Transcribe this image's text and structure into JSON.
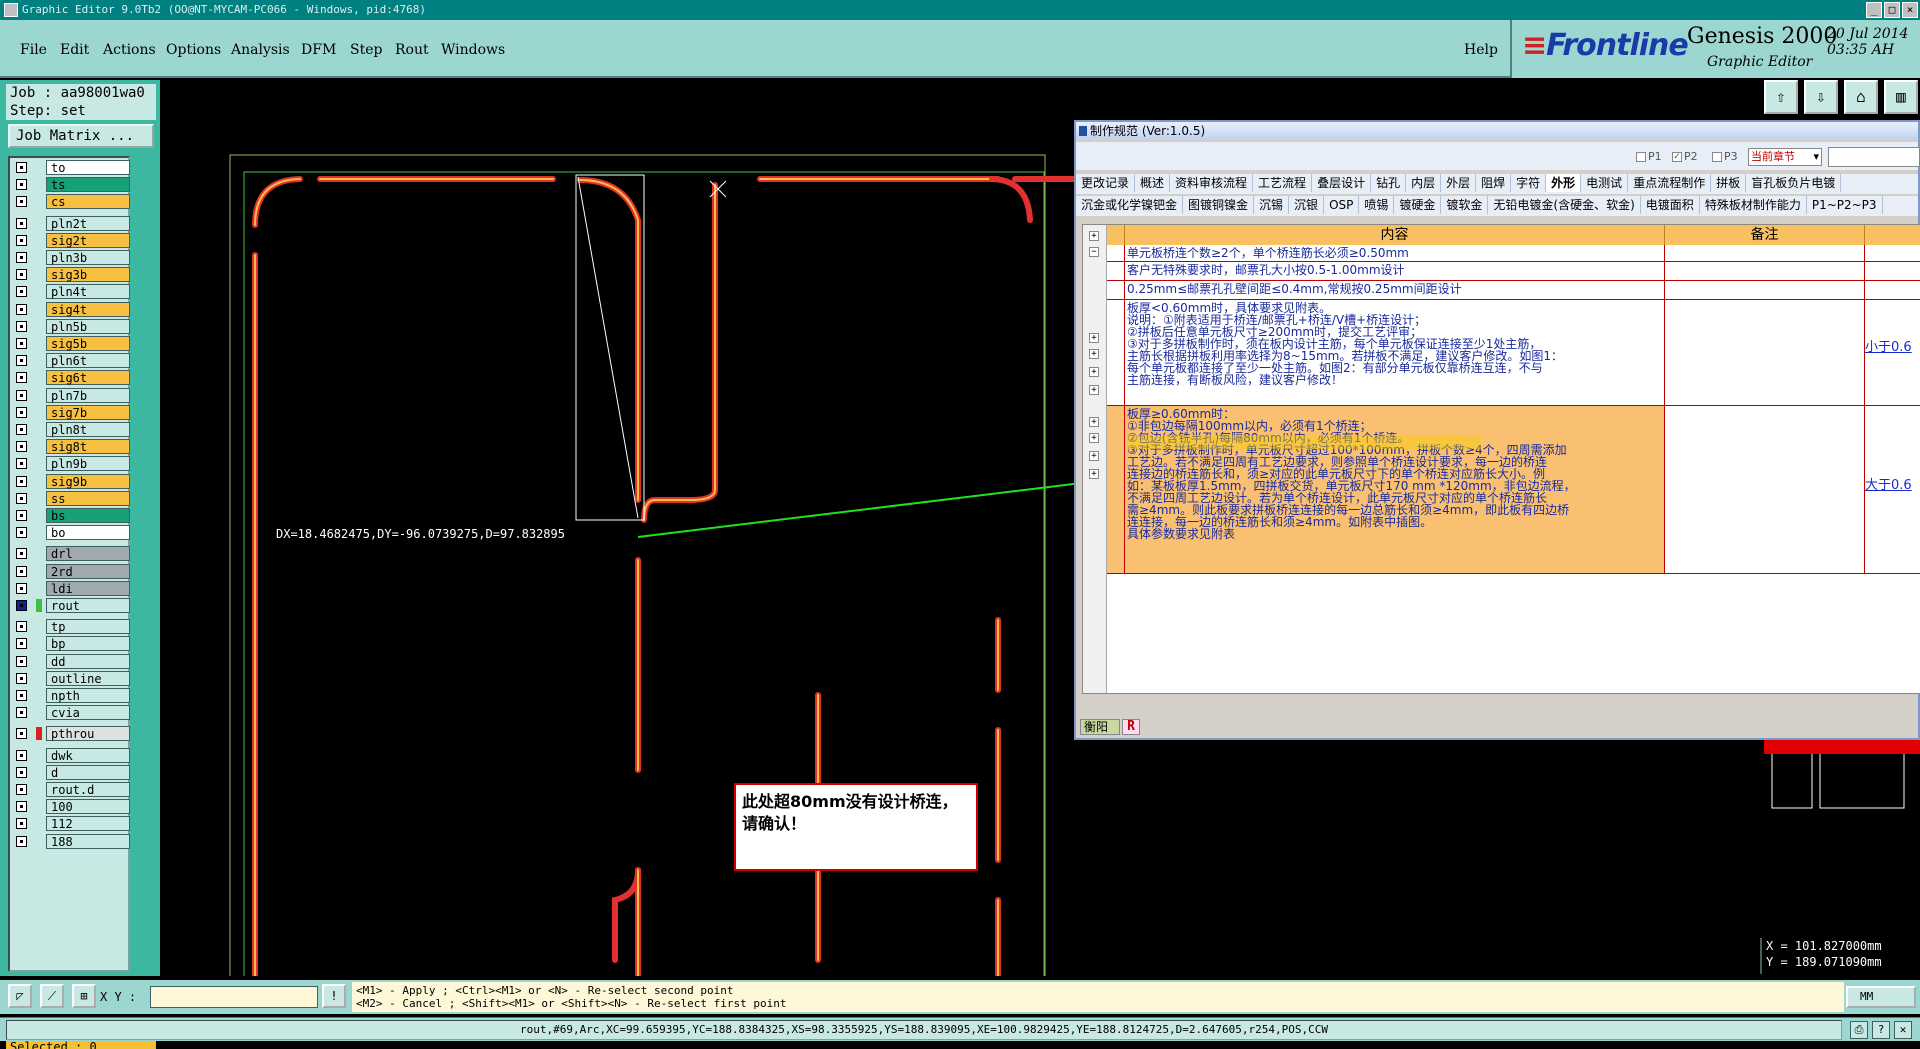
{
  "window": {
    "title": "Graphic Editor 9.0Tb2 (OO@NT-MYCAM-PC066 - Windows, pid:4768)",
    "controls": [
      "_",
      "□",
      "×"
    ]
  },
  "menu": {
    "items": [
      "File",
      "Edit",
      "Actions",
      "Options",
      "Analysis",
      "DFM",
      "Step",
      "Rout",
      "Windows"
    ],
    "help": "Help"
  },
  "brand": {
    "logo": "Frontline",
    "product": "Genesis 2000",
    "subtitle": "Graphic Editor",
    "date": "20 Jul 2014",
    "time": "03:35 AH"
  },
  "job": {
    "job_line": "Job : aa98001wa0",
    "step_line": "Step: set",
    "matrix_button": "Job Matrix ..."
  },
  "layers": [
    {
      "name": "to",
      "color": "#ffffff",
      "bg": "#ffffff"
    },
    {
      "name": "ts",
      "color": "#18a078",
      "bg": "#18a078"
    },
    {
      "name": "cs",
      "color": "#f8c040",
      "bg": "#f8c040"
    },
    {
      "name": "pln2t",
      "color": "#c8e8e4",
      "bg": "#c8e8e4"
    },
    {
      "name": "sig2t",
      "color": "#f8c040",
      "bg": "#f8c040"
    },
    {
      "name": "pln3b",
      "color": "#c8e8e4",
      "bg": "#c8e8e4"
    },
    {
      "name": "sig3b",
      "color": "#f8c040",
      "bg": "#f8c040"
    },
    {
      "name": "pln4t",
      "color": "#c8e8e4",
      "bg": "#c8e8e4"
    },
    {
      "name": "sig4t",
      "color": "#f8c040",
      "bg": "#f8c040"
    },
    {
      "name": "pln5b",
      "color": "#c8e8e4",
      "bg": "#c8e8e4"
    },
    {
      "name": "sig5b",
      "color": "#f8c040",
      "bg": "#f8c040"
    },
    {
      "name": "pln6t",
      "color": "#c8e8e4",
      "bg": "#c8e8e4"
    },
    {
      "name": "sig6t",
      "color": "#f8c040",
      "bg": "#f8c040"
    },
    {
      "name": "pln7b",
      "color": "#c8e8e4",
      "bg": "#c8e8e4"
    },
    {
      "name": "sig7b",
      "color": "#f8c040",
      "bg": "#f8c040"
    },
    {
      "name": "pln8t",
      "color": "#c8e8e4",
      "bg": "#c8e8e4"
    },
    {
      "name": "sig8t",
      "color": "#f8c040",
      "bg": "#f8c040"
    },
    {
      "name": "pln9b",
      "color": "#c8e8e4",
      "bg": "#c8e8e4"
    },
    {
      "name": "sig9b",
      "color": "#f8c040",
      "bg": "#f8c040"
    },
    {
      "name": "ss",
      "color": "#f8c040",
      "bg": "#f8c040"
    },
    {
      "name": "bs",
      "color": "#18a078",
      "bg": "#18a078"
    },
    {
      "name": "bo",
      "color": "#ffffff",
      "bg": "#ffffff"
    },
    {
      "name": "drl",
      "color": "#a0a8b0",
      "bg": "#a0a8b0"
    },
    {
      "name": "2rd",
      "color": "#a0a8b0",
      "bg": "#a0a8b0"
    },
    {
      "name": "ldi",
      "color": "#a0a8b0",
      "bg": "#a0a8b0"
    },
    {
      "name": "rout",
      "color": "#40c040",
      "bg": "#c8e8e4",
      "active": true
    },
    {
      "name": "tp",
      "color": "#c8e8e4",
      "bg": "#c8e8e4"
    },
    {
      "name": "bp",
      "color": "#c8e8e4",
      "bg": "#c8e8e4"
    },
    {
      "name": "dd",
      "color": "#c8e8e4",
      "bg": "#c8e8e4"
    },
    {
      "name": "outline",
      "color": "#c8e8e4",
      "bg": "#c8e8e4"
    },
    {
      "name": "npth",
      "color": "#c8e8e4",
      "bg": "#c8e8e4"
    },
    {
      "name": "cvia",
      "color": "#c8e8e4",
      "bg": "#c8e8e4"
    },
    {
      "name": "pthrou",
      "color": "#e02020",
      "bg": "#e0e0e0"
    },
    {
      "name": "dwk",
      "color": "#c8e8e4",
      "bg": "#c8e8e4"
    },
    {
      "name": "d",
      "color": "#c8e8e4",
      "bg": "#c8e8e4"
    },
    {
      "name": "rout.d",
      "color": "#c8e8e4",
      "bg": "#c8e8e4"
    },
    {
      "name": "100",
      "color": "#c8e8e4",
      "bg": "#c8e8e4"
    },
    {
      "name": "112",
      "color": "#c8e8e4",
      "bg": "#c8e8e4"
    },
    {
      "name": "188",
      "color": "#c8e8e4",
      "bg": "#c8e8e4"
    }
  ],
  "selected_text": "Selected : 0",
  "measure_text": "DX=18.4682475,DY=-96.0739275,D=97.832895",
  "note_text": "此处超80mm没有设计桥连，请确认！",
  "dialog": {
    "title": "制作规范  (Ver:1.0.5)",
    "options": [
      {
        "label": "P1",
        "checked": false
      },
      {
        "label": "P2",
        "checked": true
      },
      {
        "label": "P3",
        "checked": false
      }
    ],
    "chapter_select": "当前章节",
    "tabs_row1": [
      "更改记录",
      "概述",
      "资料审核流程",
      "工艺流程",
      "叠层设计",
      "钻孔",
      "内层",
      "外层",
      "阻焊",
      "字符",
      "外形",
      "电测试",
      "重点流程制作",
      "拼板",
      "盲孔板负片电镀"
    ],
    "tabs_row1_selected": "外形",
    "tabs_row2": [
      "沉金或化学镍钯金",
      "图镀铜镍金",
      "沉锡",
      "沉银",
      "OSP",
      "喷锡",
      "镀硬金",
      "镀软金",
      "无铅电镀金(含硬金、软金)",
      "电镀面积",
      "特殊板材制作能力",
      "P1~P2~P3"
    ],
    "columns": [
      "内容",
      "备注"
    ],
    "rows": [
      {
        "text": "单元板桥连个数≥2个，单个桥连筋长必须≥0.50mm",
        "note": ""
      },
      {
        "text": "客户无特殊要求时，邮票孔大小按0.5-1.00mm设计",
        "note": ""
      },
      {
        "text": "0.25mm≤邮票孔孔壁间距≤0.4mm,常规按0.25mm间距设计",
        "note": ""
      },
      {
        "text": "板厚<0.60mm时，具体要求见附表。\n说明：①附表适用于桥连/邮票孔+桥连/V槽+桥连设计；\n②拼板后任意单元板尺寸≥200mm时，提交工艺评审；\n③对于多拼板制作时，须在板内设计主筋，每个单元板保证连接至少1处主筋，\n主筋长根据拼板利用率选择为8~15mm。若拼板不满足，建议客户修改。如图1：\n每个单元板都连接了至少一处主筋。如图2：有部分单元板仅靠桥连互连，不与\n主筋连接，有断板风险，建议客户修改！",
        "note": "小于0.6"
      },
      {
        "text": "板厚≥0.60mm时：\n①非包边每隔100mm以内，必须有1个桥连；\n②包边(含铣半孔)每隔80mm以内，必须有1个桥连。\n③对于多拼板制作时，单元板尺寸超过100*100mm，拼板个数≥4个，四周需添加\n工艺边。若不满足四周有工艺边要求，则参照单个桥连设计要求，每一边的桥连\n连接边的桥连筋长和，须≥对应的此单元板尺寸下的单个桥连对应筋长大小。例\n如：某板板厚1.5mm，四拼板交货，单元板尺寸170 mm *120mm，非包边流程，\n不满足四周工艺边设计。若为单个桥连设计，此单元板尺寸对应的单个桥连筋长\n需≥4mm。则此板要求拼板桥连连接的每一边总筋长和须≥4mm，即此板有四边桥\n连连接，每一边的桥连筋长和须≥4mm。如附表中插图。\n具体参数要求见附表",
        "note": "大于0.6"
      }
    ],
    "footer_label": "衡阳",
    "footer_flag": "R"
  },
  "coords": {
    "x": "X = 101.827000mm",
    "y": "Y = 189.071090mm"
  },
  "cmd": {
    "xy_label": "X Y :",
    "hint_line1": "<M1> - Apply  ; <Ctrl><M1> or <N> - Re-select second point",
    "hint_line2": "<M2> - Cancel ; <Shift><M1> or <Shift><N> - Re-select first point",
    "unit": "MM"
  },
  "status_text": "rout,#69,Arc,XC=99.659395,YC=188.8384325,XS=98.3355925,YS=188.839095,XE=100.9829425,YE=188.8124725,D=2.647605,r254,POS,CCW"
}
